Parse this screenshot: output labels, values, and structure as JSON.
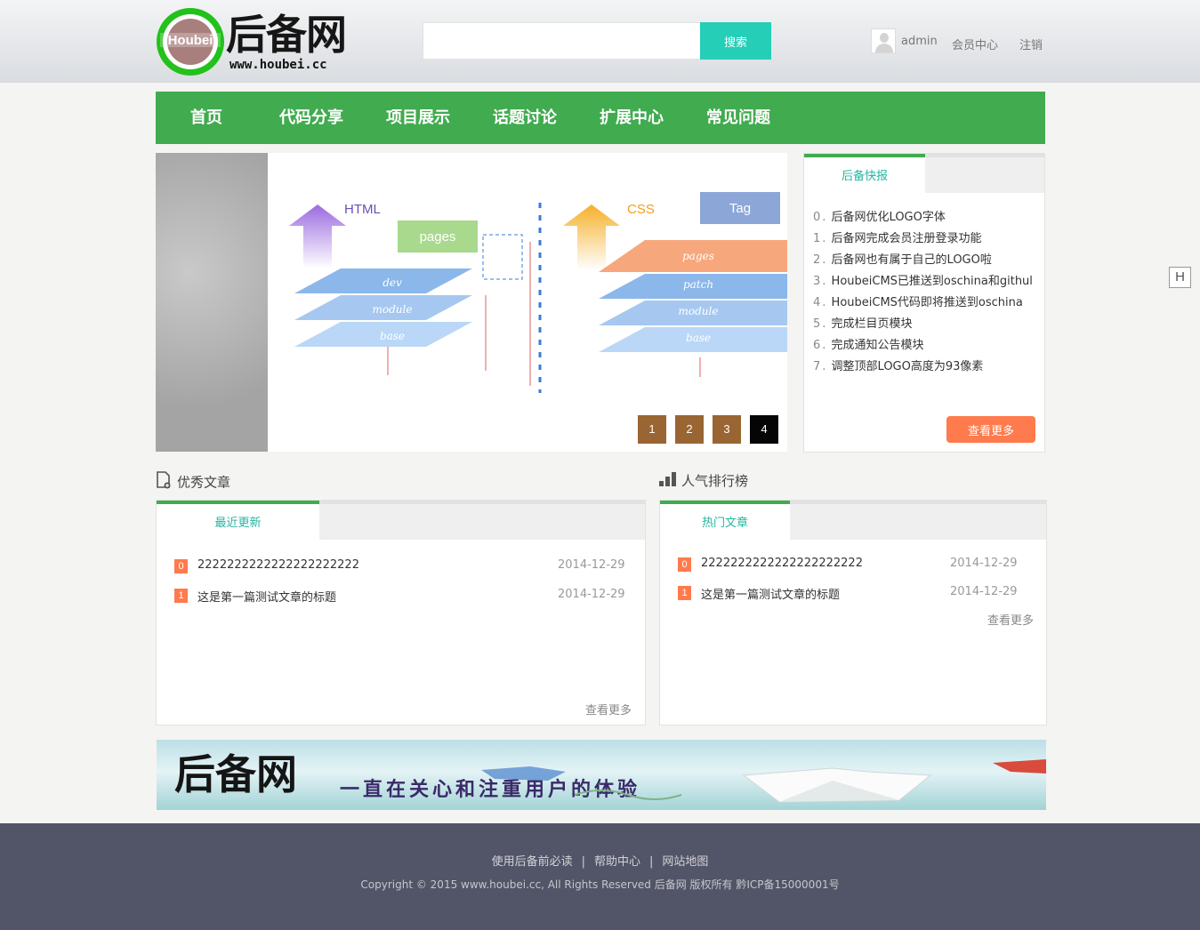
{
  "header": {
    "logo_mark": "Houbei",
    "logo_name": "后备网",
    "logo_url": "www.houbei.cc",
    "search_placeholder": "",
    "search_button": "搜索",
    "username": "admin",
    "member_center": "会员中心",
    "logout": "注销"
  },
  "nav": {
    "items": [
      "首页",
      "代码分享",
      "项目展示",
      "话题讨论",
      "扩展中心",
      "常见问题"
    ]
  },
  "slider": {
    "pages": [
      "1",
      "2",
      "3",
      "4"
    ],
    "active_page": "4",
    "diagram": {
      "left_title": "HTML",
      "right_title": "CSS",
      "left_boxes": [
        "pages"
      ],
      "left_layers": [
        "dev",
        "module",
        "base"
      ],
      "right_box": "Tag",
      "right_layers": [
        "pages",
        "patch",
        "module",
        "base"
      ]
    }
  },
  "news": {
    "tab": "后备快报",
    "items": [
      {
        "no": "0",
        "text": "后备网优化LOGO字体"
      },
      {
        "no": "1",
        "text": "后备网完成会员注册登录功能"
      },
      {
        "no": "2",
        "text": "后备网也有属于自己的LOGO啦"
      },
      {
        "no": "3",
        "text": "HoubeiCMS已推送到oschina和githul"
      },
      {
        "no": "4",
        "text": "HoubeiCMS代码即将推送到oschina"
      },
      {
        "no": "5",
        "text": "完成栏目页模块"
      },
      {
        "no": "6",
        "text": "完成通知公告模块"
      },
      {
        "no": "7",
        "text": "调整顶部LOGO高度为93像素"
      }
    ],
    "more": "查看更多"
  },
  "articles": {
    "title": "优秀文章",
    "tab": "最近更新",
    "rows": [
      {
        "rank": "0",
        "title": "2222222222222222222222",
        "date": "2014-12-29"
      },
      {
        "rank": "1",
        "title": "这是第一篇测试文章的标题",
        "date": "2014-12-29"
      }
    ],
    "more": "查看更多"
  },
  "ranking": {
    "title": "人气排行榜",
    "tab": "热门文章",
    "rows": [
      {
        "rank": "0",
        "title": "2222222222222222222222",
        "date": "2014-12-29"
      },
      {
        "rank": "1",
        "title": "这是第一篇测试文章的标题",
        "date": "2014-12-29"
      }
    ],
    "more": "查看更多"
  },
  "banner": {
    "name": "后备网",
    "slogan": "一直在关心和注重用户的体验"
  },
  "footer": {
    "links": [
      "使用后备前必读",
      "帮助中心",
      "网站地图"
    ],
    "copyright": "Copyright © 2015 www.houbei.cc, All Rights Reserved 后备网 版权所有 黔ICP备15000001号"
  },
  "float_button": "H",
  "colors": {
    "green": "#41ab4f",
    "teal": "#24ceb7",
    "orange": "#ff7a4c",
    "pager": "#996633",
    "footer": "#525567"
  }
}
